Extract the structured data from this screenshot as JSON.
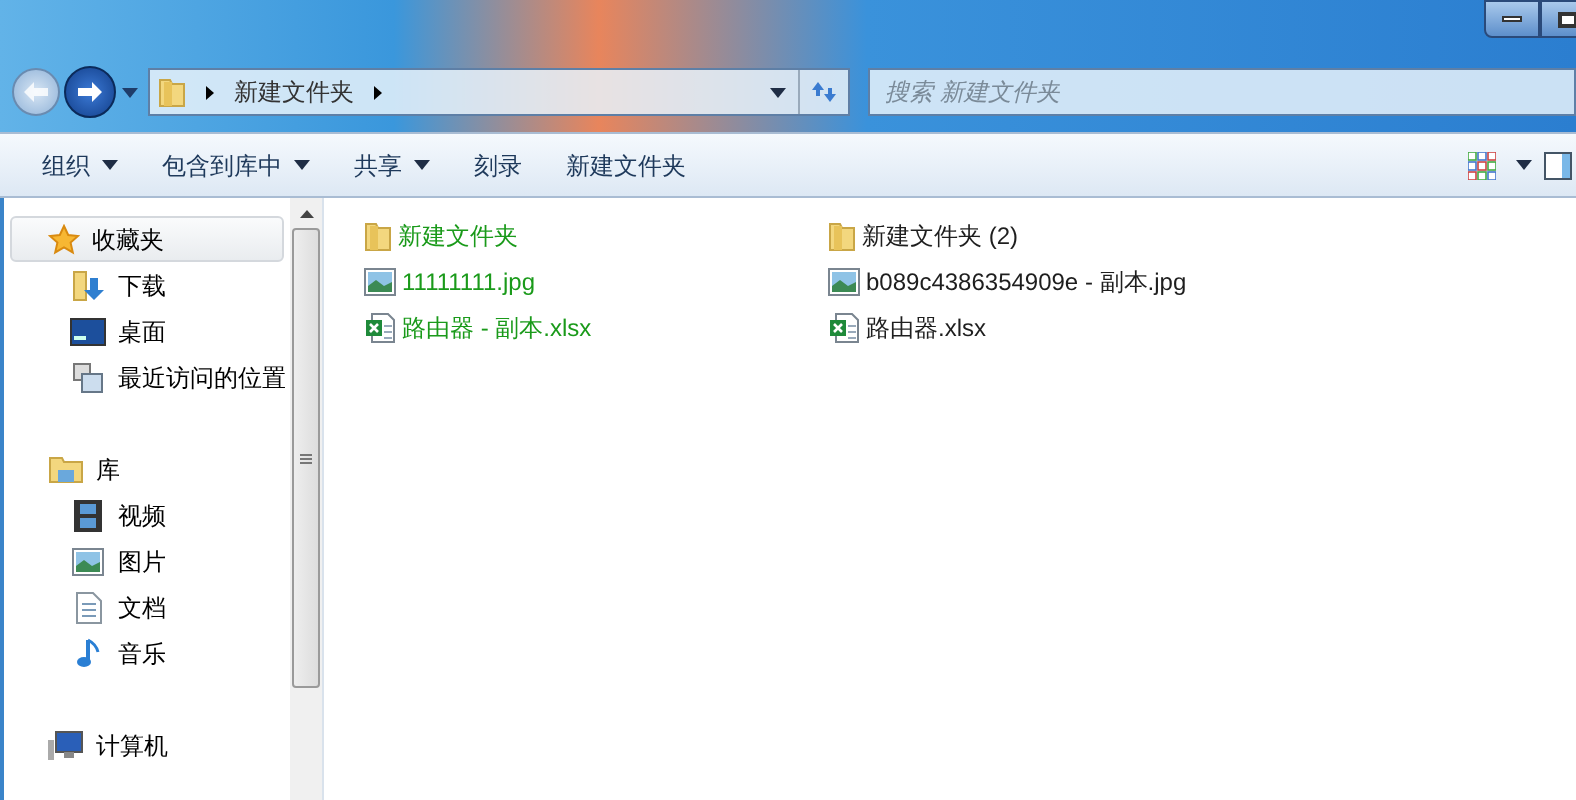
{
  "address_bar": {
    "path": [
      {
        "label": "新建文件夹"
      }
    ]
  },
  "search": {
    "placeholder": "搜索 新建文件夹"
  },
  "toolbar": {
    "items": [
      {
        "label": "组织",
        "dropdown": true
      },
      {
        "label": "包含到库中",
        "dropdown": true
      },
      {
        "label": "共享",
        "dropdown": true
      },
      {
        "label": "刻录",
        "dropdown": false
      },
      {
        "label": "新建文件夹",
        "dropdown": false
      }
    ]
  },
  "sidebar": {
    "groups": [
      {
        "label": "收藏夹",
        "kind": "favorites",
        "selected": true,
        "children": [
          {
            "label": "下载",
            "kind": "downloads"
          },
          {
            "label": "桌面",
            "kind": "desktop"
          },
          {
            "label": "最近访问的位置",
            "kind": "recent"
          }
        ]
      },
      {
        "label": "库",
        "kind": "library",
        "selected": false,
        "children": [
          {
            "label": "视频",
            "kind": "video"
          },
          {
            "label": "图片",
            "kind": "image"
          },
          {
            "label": "文档",
            "kind": "document"
          },
          {
            "label": "音乐",
            "kind": "music"
          }
        ]
      },
      {
        "label": "计算机",
        "kind": "computer",
        "selected": false
      }
    ]
  },
  "files": [
    {
      "name": "新建文件夹",
      "kind": "folder",
      "new": true
    },
    {
      "name": "新建文件夹 (2)",
      "kind": "folder",
      "new": false
    },
    {
      "name": "11111111.jpg",
      "kind": "image",
      "new": true
    },
    {
      "name": "b089c4386354909e - 副本.jpg",
      "kind": "image",
      "new": false
    },
    {
      "name": "路由器 - 副本.xlsx",
      "kind": "excel",
      "new": true
    },
    {
      "name": "路由器.xlsx",
      "kind": "excel",
      "new": false
    }
  ]
}
